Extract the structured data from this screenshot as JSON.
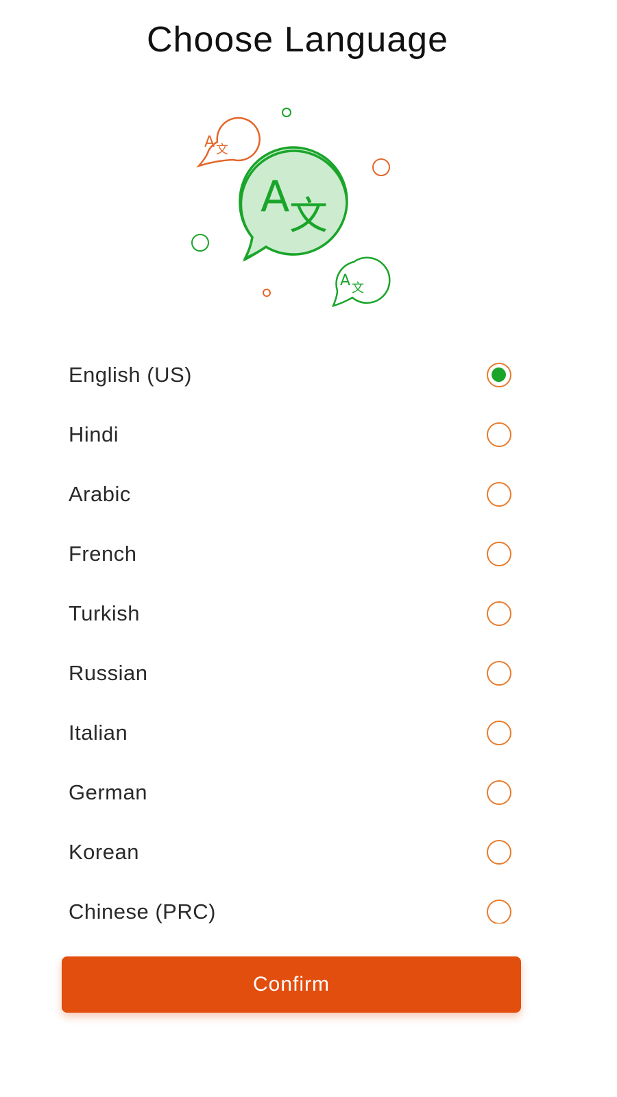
{
  "header": {
    "title": "Choose Language"
  },
  "illustration": {
    "icon": "translate-chat-icon",
    "main_glyph_latin": "A",
    "main_glyph_cjk": "文",
    "colors": {
      "green": "#1aa52a",
      "green_fill": "#cdeccf",
      "orange": "#e4662a"
    }
  },
  "languages": {
    "items": [
      {
        "label": "English (US)",
        "selected": true
      },
      {
        "label": "Hindi",
        "selected": false
      },
      {
        "label": "Arabic",
        "selected": false
      },
      {
        "label": "French",
        "selected": false
      },
      {
        "label": "Turkish",
        "selected": false
      },
      {
        "label": "Russian",
        "selected": false
      },
      {
        "label": "Italian",
        "selected": false
      },
      {
        "label": "German",
        "selected": false
      },
      {
        "label": "Korean",
        "selected": false
      },
      {
        "label": "Chinese (PRC)",
        "selected": false
      }
    ]
  },
  "footer": {
    "confirm_label": "Confirm"
  },
  "theme": {
    "accent": "#e24e0e",
    "radio_border": "#e87b2c",
    "radio_selected": "#1aa52a"
  }
}
